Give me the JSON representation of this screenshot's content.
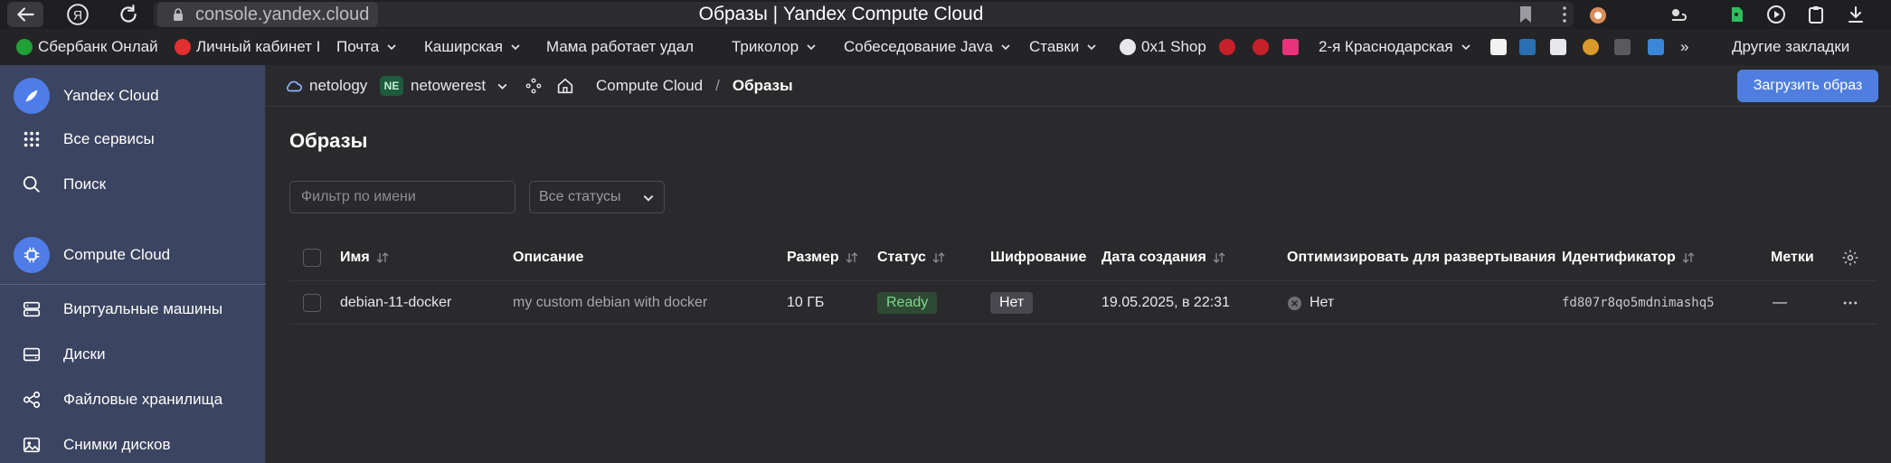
{
  "browser": {
    "url_host": "console.yandex.cloud",
    "page_title": "Образы | Yandex Compute Cloud"
  },
  "bookmarks": [
    {
      "label": "Сбербанк Онлайн",
      "color": "#21a038"
    },
    {
      "label": "Личный кабинет I",
      "color": "#e03030"
    },
    {
      "label": "Почта"
    },
    {
      "label": "Каширская"
    },
    {
      "label": "Мама работает удал"
    },
    {
      "label": "Триколор"
    },
    {
      "label": "Собеседование Java"
    },
    {
      "label": "Ставки"
    },
    {
      "label": "0x1 Shop"
    },
    {
      "label": "2-я Краснодарская"
    },
    {
      "label": "»"
    },
    {
      "label": "Другие закладки"
    }
  ],
  "sidebar": {
    "brand": "Yandex Cloud",
    "all_services": "Все сервисы",
    "search": "Поиск",
    "service": "Compute Cloud",
    "items": [
      {
        "label": "Виртуальные машины"
      },
      {
        "label": "Диски"
      },
      {
        "label": "Файловые хранилища"
      },
      {
        "label": "Снимки дисков"
      }
    ]
  },
  "header": {
    "cloud": "netology",
    "folder_badge": "NE",
    "folder": "netowerest",
    "breadcrumb_service": "Compute Cloud",
    "breadcrumb_sep": "/",
    "breadcrumb_current": "Образы",
    "upload_button": "Загрузить образ"
  },
  "main": {
    "title": "Образы",
    "filter_placeholder": "Фильтр по имени",
    "status_select": "Все статусы",
    "columns": {
      "name": "Имя",
      "description": "Описание",
      "size": "Размер",
      "status": "Статус",
      "encryption": "Шифрование",
      "created": "Дата создания",
      "optimize": "Оптимизировать для развертывания",
      "id": "Идентификатор",
      "labels": "Метки"
    },
    "rows": [
      {
        "name": "debian-11-docker",
        "description": "my custom debian with docker",
        "size": "10 ГБ",
        "status": "Ready",
        "encryption": "Нет",
        "created": "19.05.2025, в 22:31",
        "optimize": "Нет",
        "id": "fd807r8qo5mdnimashq5",
        "labels": "—"
      }
    ]
  },
  "colors": {
    "accent": "#4f7ee0",
    "sidebar": "#3b4460",
    "status_ready": "#7fd68d"
  }
}
